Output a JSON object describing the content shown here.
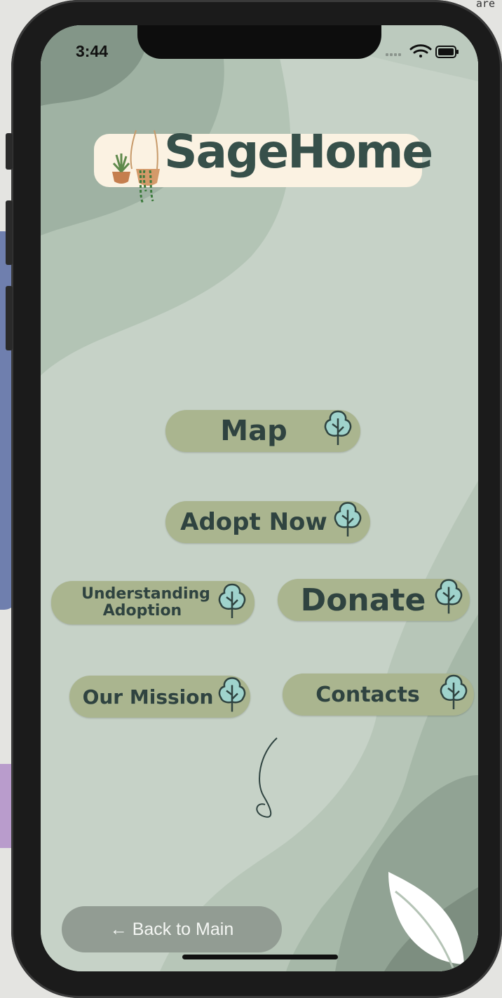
{
  "desktop": {
    "corner_text": "are"
  },
  "status_bar": {
    "time": "3:44"
  },
  "logo": {
    "title": "SageHome"
  },
  "menu": {
    "map": "Map",
    "adopt_now": "Adopt Now",
    "understanding_adoption_line1": "Understanding",
    "understanding_adoption_line2": "Adoption",
    "donate": "Donate",
    "our_mission": "Our Mission",
    "contacts": "Contacts"
  },
  "footer": {
    "back_label": "← Back to Main"
  },
  "colors": {
    "background": "#c8d4c8",
    "button": "#aab58f",
    "button_text": "#2f4340",
    "tree_icon": "#9fd3cc",
    "logo_banner": "#fbf2e2"
  },
  "icons": [
    "wifi-icon",
    "battery-icon",
    "signal-icon",
    "tree-icon",
    "leaf-icon",
    "hanging-plant-icon"
  ]
}
